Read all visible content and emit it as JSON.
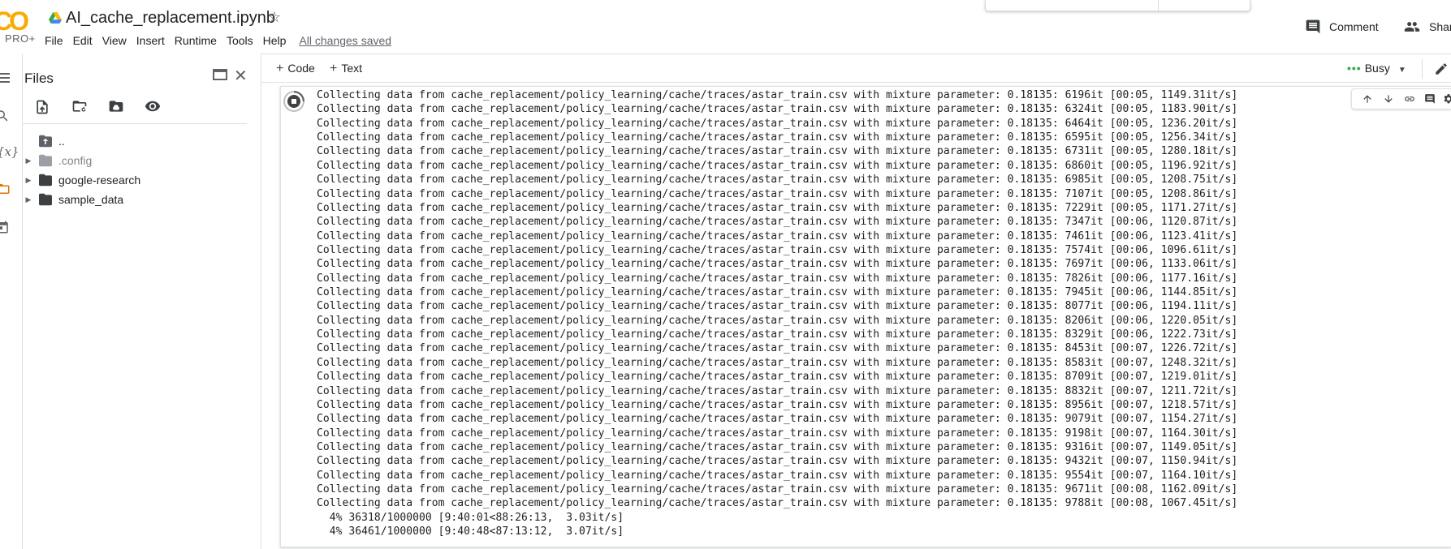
{
  "app": {
    "logo_text": "CO",
    "tier": "PRO+",
    "notebook_title": "AI_cache_replacement.ipynb",
    "save_status": "All changes saved"
  },
  "menu": [
    "File",
    "Edit",
    "View",
    "Insert",
    "Runtime",
    "Tools",
    "Help"
  ],
  "header_actions": {
    "comment_label": "Comment",
    "share_label": "Share"
  },
  "toolbar": {
    "add_code_label": "Code",
    "add_text_label": "Text",
    "runtime_status": "Busy"
  },
  "icons": {
    "drive": "google-drive-icon",
    "star": "star-outline-icon",
    "comment": "comment-icon",
    "share": "people-icon",
    "edit": "pencil-icon",
    "menu": "hamburger-icon",
    "search": "search-icon",
    "variables": "variables-icon",
    "files": "folder-icon",
    "snippets": "calendar-icon"
  },
  "files_pane": {
    "title": "Files",
    "tree": [
      {
        "name": "..",
        "type": "parent",
        "expandable": false,
        "muted": false
      },
      {
        "name": ".config",
        "type": "folder",
        "expandable": true,
        "muted": true
      },
      {
        "name": "google-research",
        "type": "folder",
        "expandable": true,
        "muted": false
      },
      {
        "name": "sample_data",
        "type": "folder",
        "expandable": true,
        "muted": false
      }
    ]
  },
  "output": {
    "prefix": "Collecting data from cache_replacement/policy_learning/cache/traces/astar_train.csv with mixture parameter: 0.18135: ",
    "progress_rows": [
      [
        "6196it",
        "00:05",
        "1149.31it/s"
      ],
      [
        "6324it",
        "00:05",
        "1183.90it/s"
      ],
      [
        "6464it",
        "00:05",
        "1236.20it/s"
      ],
      [
        "6595it",
        "00:05",
        "1256.34it/s"
      ],
      [
        "6731it",
        "00:05",
        "1280.18it/s"
      ],
      [
        "6860it",
        "00:05",
        "1196.92it/s"
      ],
      [
        "6985it",
        "00:05",
        "1208.75it/s"
      ],
      [
        "7107it",
        "00:05",
        "1208.86it/s"
      ],
      [
        "7229it",
        "00:05",
        "1171.27it/s"
      ],
      [
        "7347it",
        "00:06",
        "1120.87it/s"
      ],
      [
        "7461it",
        "00:06",
        "1123.41it/s"
      ],
      [
        "7574it",
        "00:06",
        "1096.61it/s"
      ],
      [
        "7697it",
        "00:06",
        "1133.06it/s"
      ],
      [
        "7826it",
        "00:06",
        "1177.16it/s"
      ],
      [
        "7945it",
        "00:06",
        "1144.85it/s"
      ],
      [
        "8077it",
        "00:06",
        "1194.11it/s"
      ],
      [
        "8206it",
        "00:06",
        "1220.05it/s"
      ],
      [
        "8329it",
        "00:06",
        "1222.73it/s"
      ],
      [
        "8453it",
        "00:07",
        "1226.72it/s"
      ],
      [
        "8583it",
        "00:07",
        "1248.32it/s"
      ],
      [
        "8709it",
        "00:07",
        "1219.01it/s"
      ],
      [
        "8832it",
        "00:07",
        "1211.72it/s"
      ],
      [
        "8956it",
        "00:07",
        "1218.57it/s"
      ],
      [
        "9079it",
        "00:07",
        "1154.27it/s"
      ],
      [
        "9198it",
        "00:07",
        "1164.30it/s"
      ],
      [
        "9316it",
        "00:07",
        "1149.05it/s"
      ],
      [
        "9432it",
        "00:07",
        "1150.94it/s"
      ],
      [
        "9554it",
        "00:07",
        "1164.10it/s"
      ],
      [
        "9671it",
        "00:08",
        "1162.09it/s"
      ],
      [
        "9788it",
        "00:08",
        "1067.45it/s"
      ]
    ],
    "summary_lines": [
      "  4% 36318/1000000 [9:40:01<88:26:13,  3.03it/s]",
      "  4% 36461/1000000 [9:40:48<87:13:12,  3.07it/s]"
    ]
  }
}
